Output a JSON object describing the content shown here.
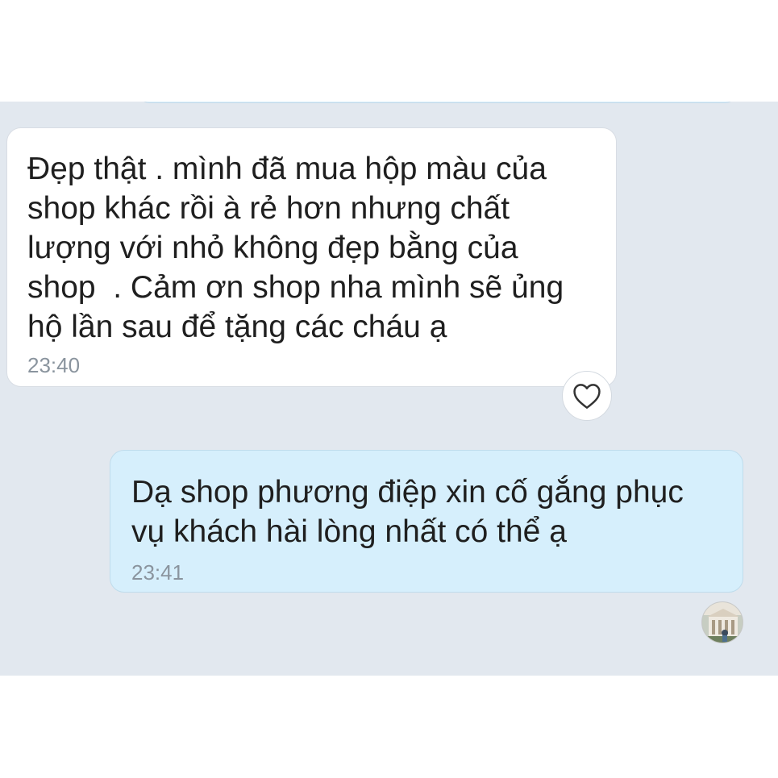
{
  "conversation": {
    "messages": [
      {
        "direction": "incoming",
        "text": "Đẹp thật . mình đã mua hộp màu của\nshop khác rồi à rẻ hơn nhưng chất\nlượng với nhỏ không đẹp bằng của\nshop  . Cảm ơn shop nha mình sẽ ủng\nhộ lần sau để tặng các cháu ạ",
        "time": "23:40",
        "reaction_icon": "heart-outline-icon"
      },
      {
        "direction": "outgoing",
        "text": "Dạ shop phương điệp xin cố gắng phục\nvụ khách hài lòng nhất có thể ạ",
        "time": "23:41",
        "sender_avatar": "avatar-photo"
      }
    ]
  },
  "colors": {
    "chat_background": "#e2e8ef",
    "incoming_bubble": "#ffffff",
    "outgoing_bubble": "#d6effc",
    "timestamp": "#8a949e"
  }
}
